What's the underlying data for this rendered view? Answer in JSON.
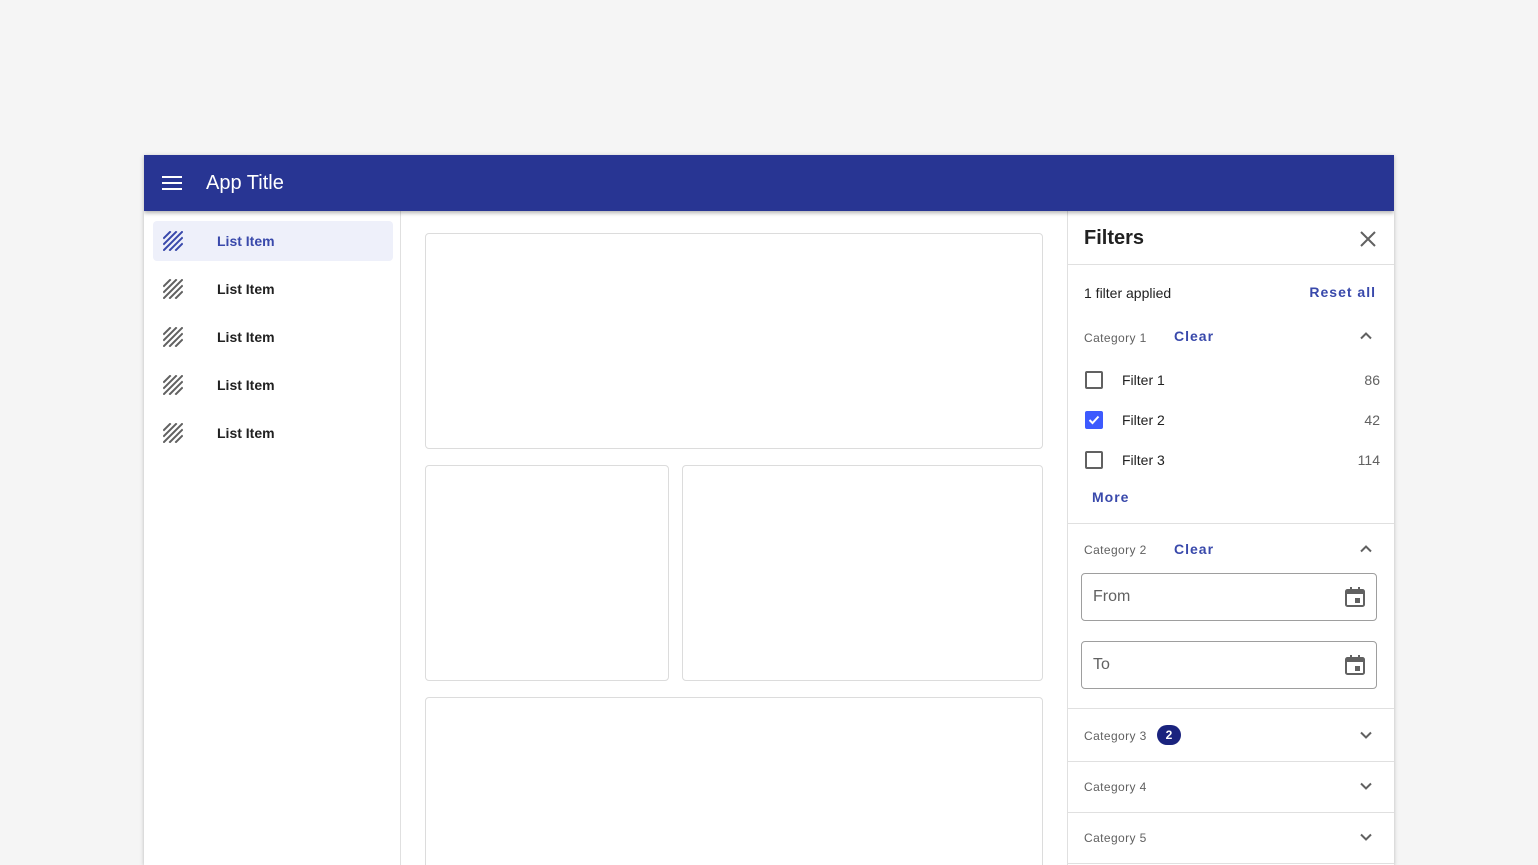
{
  "app": {
    "title": "App Title",
    "menu_icon": "menu-icon"
  },
  "sidebar": {
    "items": [
      {
        "label": "List Item",
        "icon": "hatched-placeholder-icon",
        "active": true
      },
      {
        "label": "List Item",
        "icon": "hatched-placeholder-icon",
        "active": false
      },
      {
        "label": "List Item",
        "icon": "hatched-placeholder-icon",
        "active": false
      },
      {
        "label": "List Item",
        "icon": "hatched-placeholder-icon",
        "active": false
      },
      {
        "label": "List Item",
        "icon": "hatched-placeholder-icon",
        "active": false
      }
    ]
  },
  "filters": {
    "title": "Filters",
    "applied_text": "1 filter applied",
    "reset_label": "Reset all",
    "categories": [
      {
        "label": "Category 1",
        "clear_label": "Clear",
        "expanded": true,
        "options": [
          {
            "label": "Filter 1",
            "count": "86",
            "checked": false
          },
          {
            "label": "Filter 2",
            "count": "42",
            "checked": true
          },
          {
            "label": "Filter 3",
            "count": "114",
            "checked": false
          }
        ],
        "more_label": "More"
      },
      {
        "label": "Category 2",
        "clear_label": "Clear",
        "expanded": true,
        "from_placeholder": "From",
        "to_placeholder": "To"
      },
      {
        "label": "Category 3",
        "badge": "2",
        "expanded": false
      },
      {
        "label": "Category 4",
        "expanded": false
      },
      {
        "label": "Category 5",
        "expanded": false
      }
    ]
  },
  "colors": {
    "primary": "#283593",
    "accent": "#3949ab",
    "checkbox": "#3d5afe",
    "badge": "#1a237e"
  }
}
